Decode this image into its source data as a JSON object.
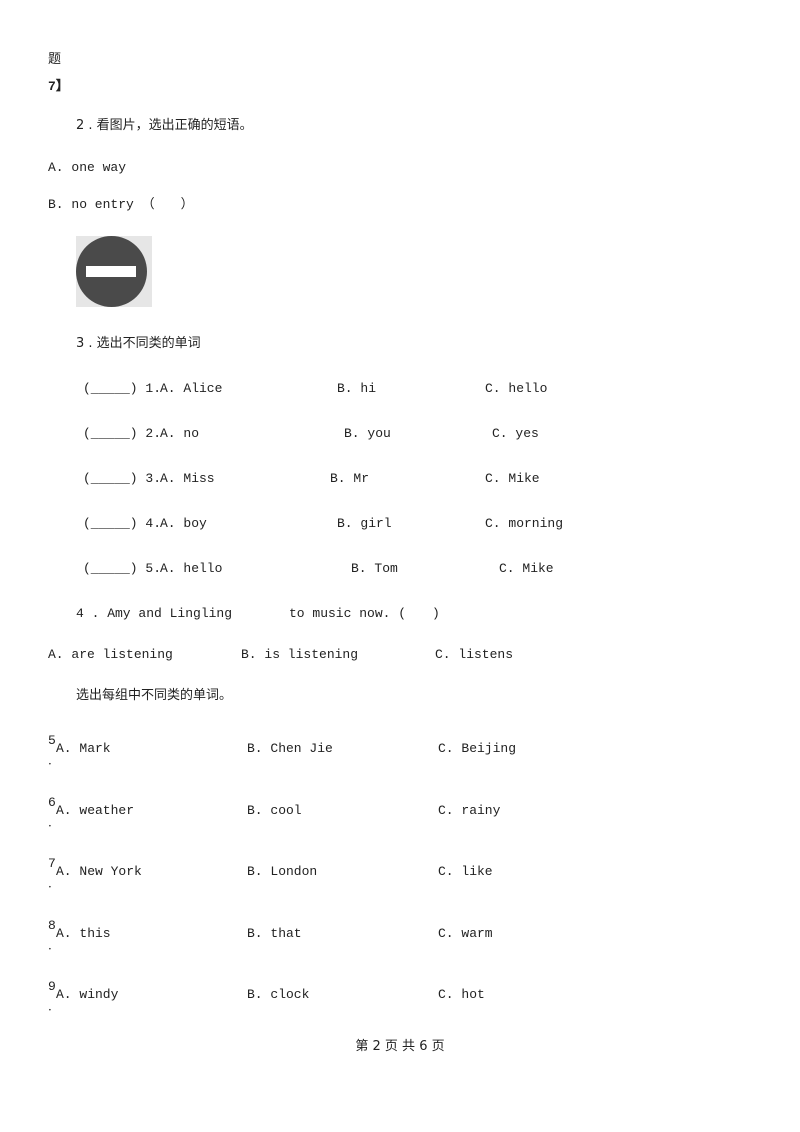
{
  "header_fragment": {
    "line1": "题",
    "line2": "7】"
  },
  "q2": {
    "prompt": "2 . 看图片，选出正确的短语。",
    "option_a": "A. one way",
    "option_b": "B. no entry （　　）",
    "image": "no-entry-sign-icon"
  },
  "q3": {
    "prompt": "3 . 选出不同类的单词",
    "rows": [
      {
        "blank": "(_____) 1.",
        "a": "A. Alice",
        "b": "B. hi",
        "c": "C. hello"
      },
      {
        "blank": "(_____) 2.",
        "a": "A. no",
        "b": "B. you",
        "c": "C. yes"
      },
      {
        "blank": "(_____) 3.",
        "a": "A. Miss",
        "b": "B. Mr",
        "c": "C. Mike"
      },
      {
        "blank": "(_____) 4.",
        "a": "A. boy",
        "b": "B. girl",
        "c": "C. morning"
      },
      {
        "blank": "(_____) 5.",
        "a": "A. hello",
        "b": "B. Tom",
        "c": "C. Mike"
      }
    ]
  },
  "q4": {
    "prompt_part1": "4 . Amy and Lingling",
    "prompt_part2": "to music now. (　　)",
    "option_a": "A. are listening",
    "option_b": "B. is listening",
    "option_c": "C. listens"
  },
  "section": {
    "instruction": "选出每组中不同类的单词。"
  },
  "groups": [
    {
      "num": "5",
      "a": "A. Mark",
      "b": "B. Chen Jie",
      "c": "C. Beijing"
    },
    {
      "num": "6",
      "a": "A. weather",
      "b": "B. cool",
      "c": "C. rainy"
    },
    {
      "num": "7",
      "a": "A. New York",
      "b": "B. London",
      "c": "C. like"
    },
    {
      "num": "8",
      "a": "A. this",
      "b": "B. that",
      "c": "C. warm"
    },
    {
      "num": "9",
      "a": "A. windy",
      "b": "B. clock",
      "c": "C. hot"
    }
  ],
  "footer": {
    "page_label": "第 2 页 共 6 页"
  }
}
